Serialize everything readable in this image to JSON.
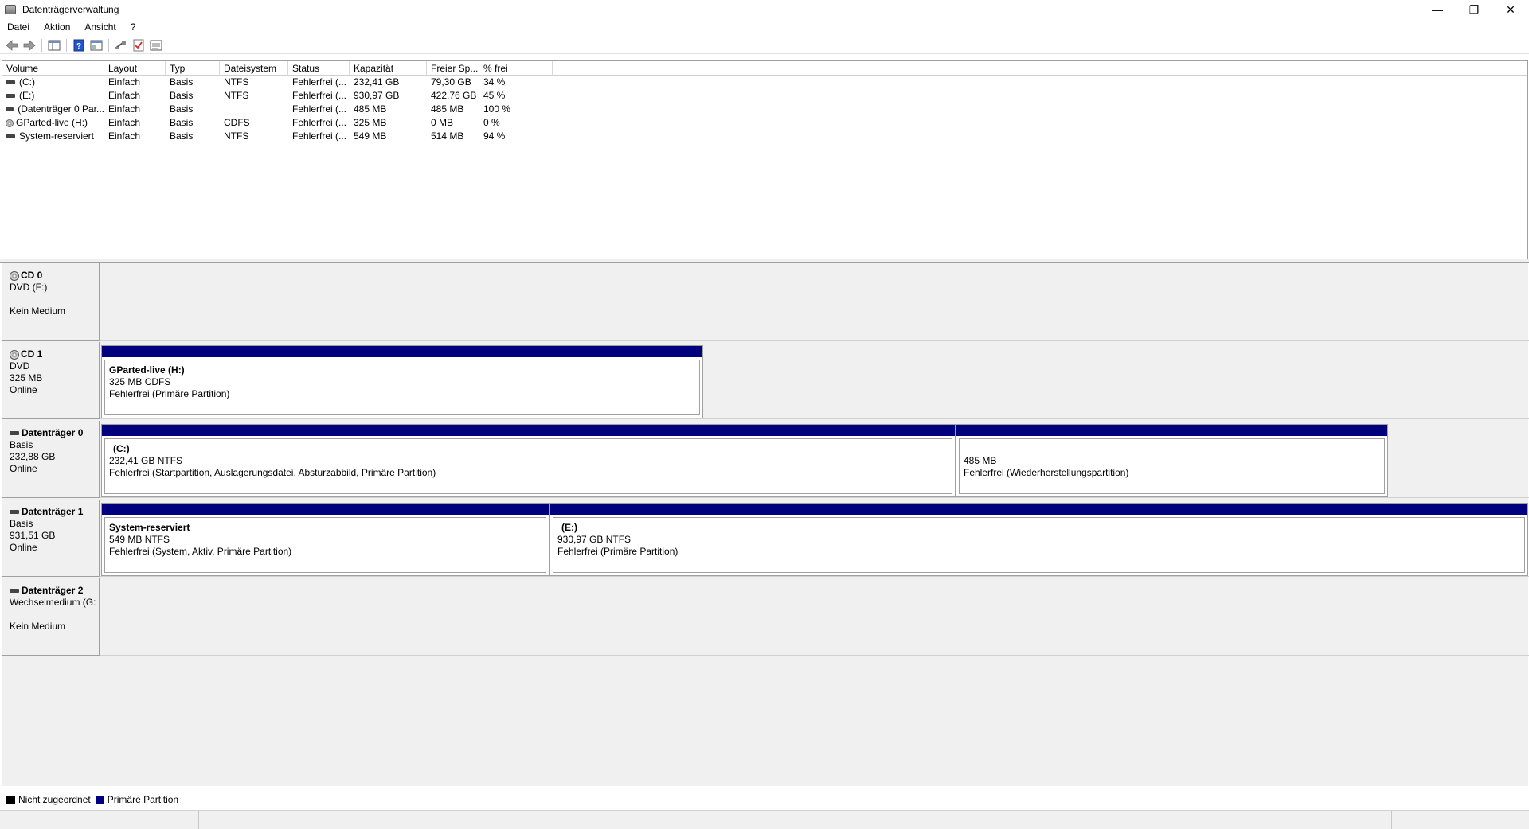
{
  "window": {
    "title": "Datenträgerverwaltung",
    "minimize": "—",
    "restore": "❐",
    "close": "✕"
  },
  "menu": [
    "Datei",
    "Aktion",
    "Ansicht",
    "?"
  ],
  "toolbar": {
    "icons": [
      "back-arrow-icon",
      "forward-arrow-icon",
      "console-tree-icon",
      "help-icon",
      "properties-icon",
      "connect-icon",
      "check-icon",
      "settings-list-icon"
    ]
  },
  "volume_list": {
    "columns": [
      "Volume",
      "Layout",
      "Typ",
      "Dateisystem",
      "Status",
      "Kapazität",
      "Freier Sp...",
      "% frei"
    ],
    "rows": [
      {
        "volume": "(C:)",
        "layout": "Einfach",
        "type": "Basis",
        "fs": "NTFS",
        "status": "Fehlerfrei (...",
        "capacity": "232,41 GB",
        "free": "79,30 GB",
        "pct": "34 %",
        "icon": "drive"
      },
      {
        "volume": "(E:)",
        "layout": "Einfach",
        "type": "Basis",
        "fs": "NTFS",
        "status": "Fehlerfrei (...",
        "capacity": "930,97 GB",
        "free": "422,76 GB",
        "pct": "45 %",
        "icon": "drive"
      },
      {
        "volume": "(Datenträger 0 Par...",
        "layout": "Einfach",
        "type": "Basis",
        "fs": "",
        "status": "Fehlerfrei (...",
        "capacity": "485 MB",
        "free": "485 MB",
        "pct": "100 %",
        "icon": "drive"
      },
      {
        "volume": "GParted-live (H:)",
        "layout": "Einfach",
        "type": "Basis",
        "fs": "CDFS",
        "status": "Fehlerfrei (...",
        "capacity": "325 MB",
        "free": "0 MB",
        "pct": "0 %",
        "icon": "cd"
      },
      {
        "volume": "System-reserviert",
        "layout": "Einfach",
        "type": "Basis",
        "fs": "NTFS",
        "status": "Fehlerfrei (...",
        "capacity": "549 MB",
        "free": "514 MB",
        "pct": "94 %",
        "icon": "drive"
      }
    ]
  },
  "disks": {
    "cd0": {
      "name": "CD 0",
      "line1": "DVD (F:)",
      "line2": "",
      "line3": "Kein Medium"
    },
    "cd1": {
      "name": "CD 1",
      "line1": "DVD",
      "line2": "325 MB",
      "line3": "Online",
      "partitions": [
        {
          "title": "GParted-live  (H:)",
          "size": "325 MB CDFS",
          "status": "Fehlerfrei (Primäre Partition)"
        }
      ]
    },
    "disk0": {
      "name": "Datenträger 0",
      "line1": "Basis",
      "line2": "232,88 GB",
      "line3": "Online",
      "partitions": [
        {
          "title": "(C:)",
          "size": "232,41 GB NTFS",
          "status": "Fehlerfrei (Startpartition, Auslagerungsdatei, Absturzabbild, Primäre Partition)"
        },
        {
          "title": "",
          "size": "485 MB",
          "status": "Fehlerfrei (Wiederherstellungspartition)"
        }
      ]
    },
    "disk1": {
      "name": "Datenträger 1",
      "line1": "Basis",
      "line2": "931,51 GB",
      "line3": "Online",
      "partitions": [
        {
          "title": "System-reserviert",
          "size": "549 MB NTFS",
          "status": "Fehlerfrei (System, Aktiv, Primäre Partition)"
        },
        {
          "title": "(E:)",
          "size": "930,97 GB NTFS",
          "status": "Fehlerfrei (Primäre Partition)"
        }
      ]
    },
    "disk2": {
      "name": "Datenträger 2",
      "line1": "Wechselmedium (G:",
      "line2": "",
      "line3": "Kein Medium"
    }
  },
  "legend": {
    "unallocated": {
      "label": "Nicht zugeordnet",
      "color": "#000000"
    },
    "primary": {
      "label": "Primäre Partition",
      "color": "#00007f"
    }
  }
}
